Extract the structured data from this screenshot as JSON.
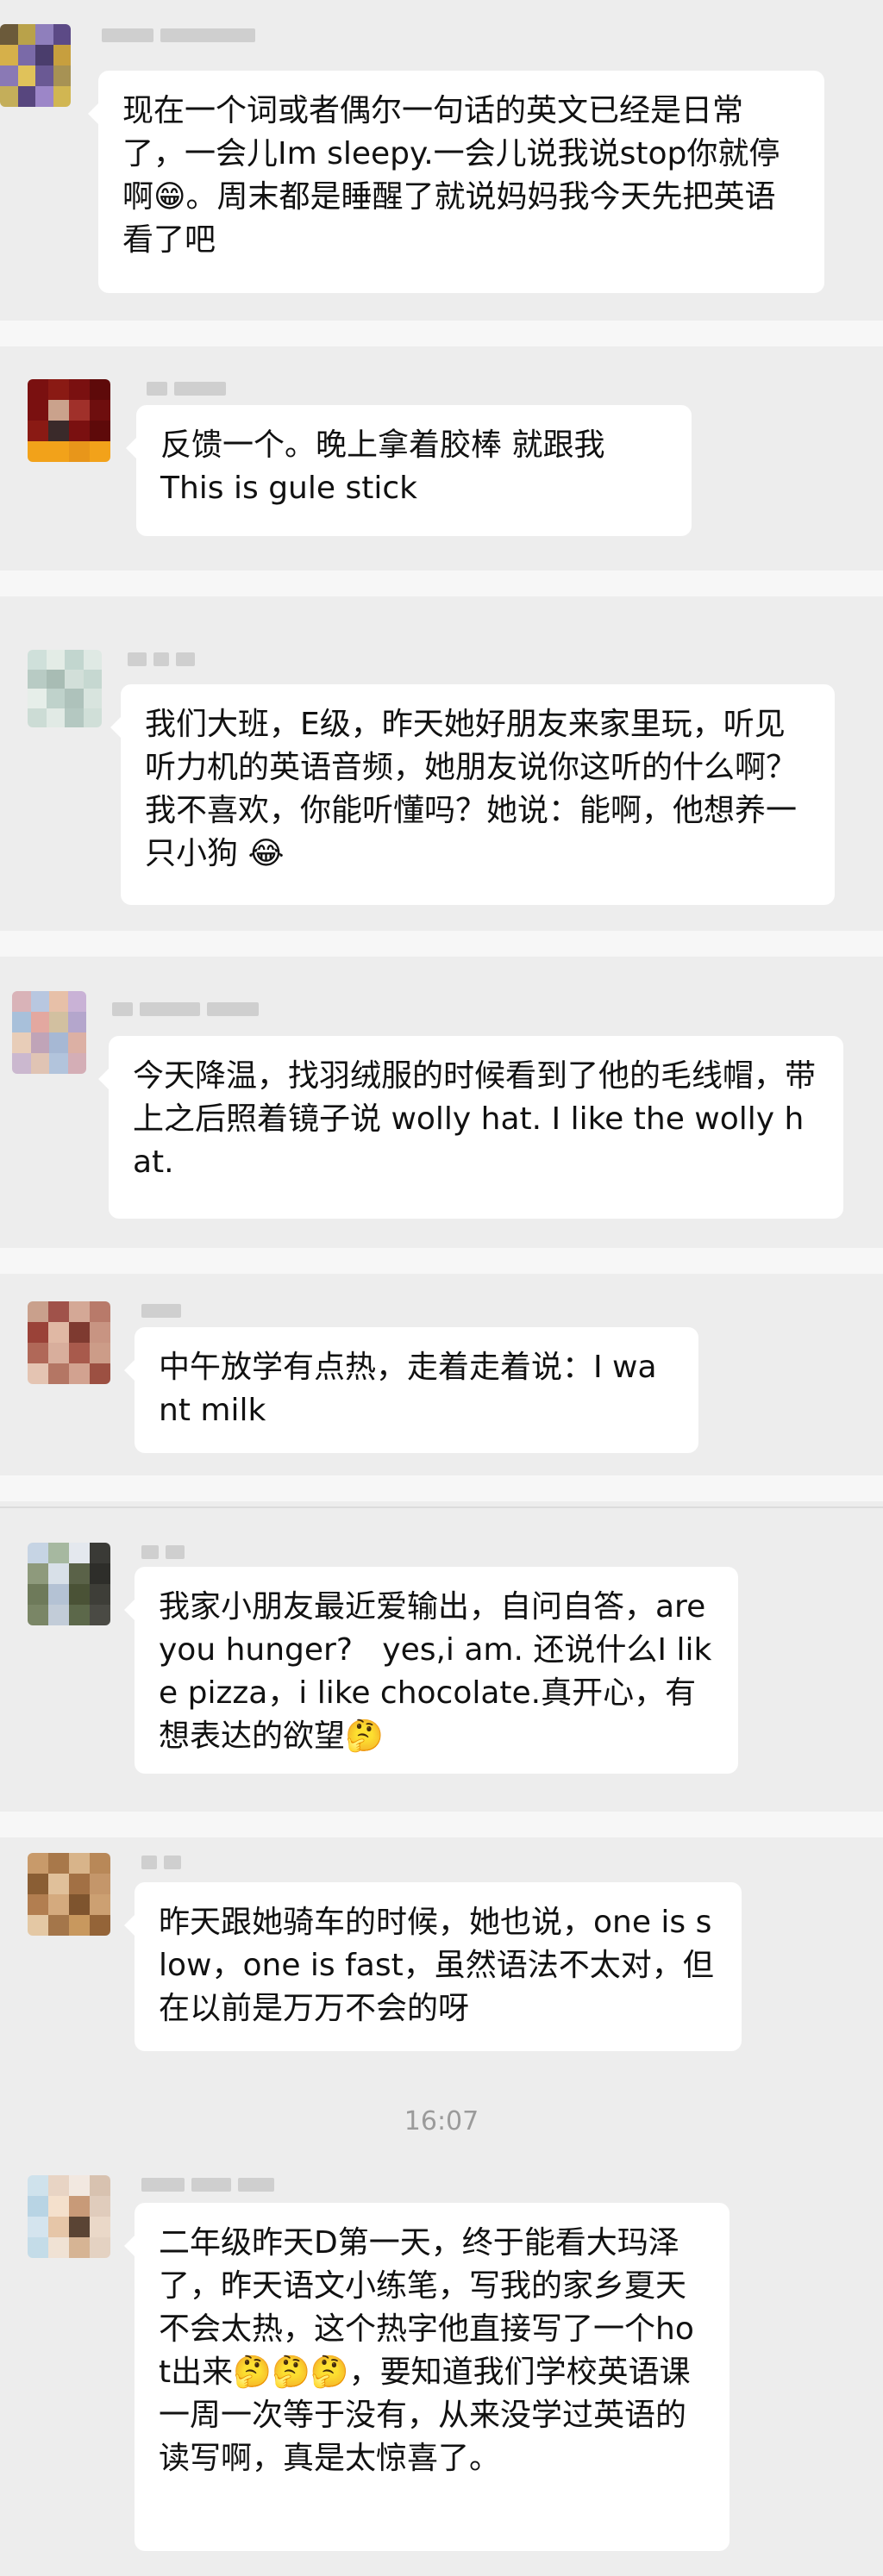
{
  "messages": [
    {
      "text": "现在一个词或者偶尔一句话的英文已经是日常了，一会儿Im sleepy.一会儿说我说stop你就停啊😁。周末都是睡醒了就说妈妈我今天先把英语看了吧"
    },
    {
      "text": "反馈一个。晚上拿着胶棒 就跟我\nThis is gule stick"
    },
    {
      "text": "我们大班，E级，昨天她好朋友来家里玩，听见听力机的英语音频，她朋友说你这听的什么啊？我不喜欢，你能听懂吗？她说：能啊，他想养一只小狗 😂"
    },
    {
      "text": "今天降温，找羽绒服的时候看到了他的毛线帽，带上之后照着镜子说 wolly hat. I like the wolly hat."
    },
    {
      "text": "中午放学有点热，走着走着说：I want milk"
    },
    {
      "text": "我家小朋友最近爱输出，自问自答，are you hunger?   yes,i am. 还说什么I like pizza，i like chocolate.真开心，有想表达的欲望🤔"
    },
    {
      "text": "昨天跟她骑车的时候，她也说，one is slow，one is fast，虽然语法不太对，但在以前是万万不会的呀"
    },
    {
      "text": "二年级昨天D第一天，终于能看大玛泽了，昨天语文小练笔，写我的家乡夏天不会太热，这个热字他直接写了一个hot出来🤔🤔🤔，要知道我们学校英语课一周一次等于没有，从来没学过英语的读写啊，真是太惊喜了。"
    }
  ],
  "timestamp": "16:07",
  "colors": {
    "chat_background": "#ededed",
    "bubble": "#ffffff",
    "text": "#111111",
    "timestamp": "#9b9b9b"
  }
}
